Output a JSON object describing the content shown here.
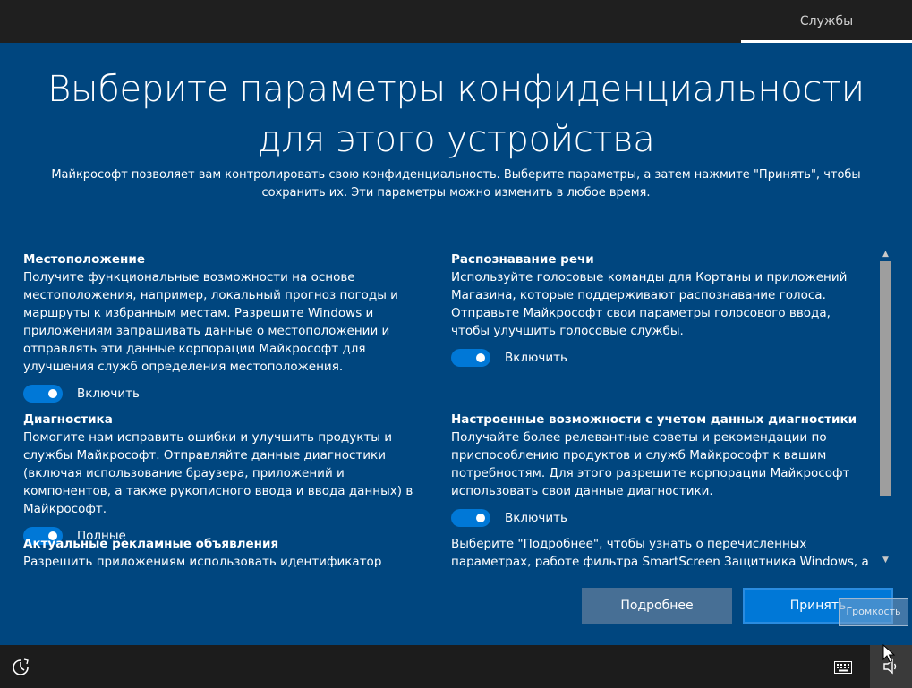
{
  "topbar": {
    "services_tab": "Службы"
  },
  "main": {
    "title": "Выберите параметры конфиденциальности для этого устройства",
    "subtitle": "Майкрософт позволяет вам контролировать свою конфиденциальность. Выберите параметры, а затем нажмите \"Принять\", чтобы сохранить их. Эти параметры можно изменить в любое время."
  },
  "sections_left": [
    {
      "title": "Местоположение",
      "text": "Получите функциональные возможности на основе местоположения, например, локальный прогноз погоды и маршруты к избранным местам. Разрешите Windows и приложениям запрашивать данные о местоположении и отправлять эти данные корпорации Майкрософт для улучшения служб определения местоположения.",
      "toggle_label": "Включить",
      "toggle_on": true
    },
    {
      "title": "Диагностика",
      "text": "Помогите нам исправить ошибки и улучшить продукты и службы Майкрософт. Отправляйте данные диагностики (включая использование браузера, приложений и компонентов, а также рукописного ввода и ввода данных) в Майкрософт.",
      "toggle_label": "Полные",
      "toggle_on": true
    },
    {
      "title": "Актуальные рекламные объявления",
      "text": "Разрешить приложениям использовать идентификатор рекламы,"
    }
  ],
  "sections_right": [
    {
      "title": "Распознавание речи",
      "text": "Используйте голосовые команды для Кортаны и приложений Магазина, которые поддерживают распознавание голоса. Отправьте Майкрософт свои параметры голосового ввода, чтобы улучшить голосовые службы.",
      "toggle_label": "Включить",
      "toggle_on": true
    },
    {
      "title": "Настроенные возможности с учетом данных диагностики",
      "text": "Получайте более релевантные советы и рекомендации по приспособлению продуктов и служб Майкрософт к вашим потребностям. Для этого разрешите корпорации Майкрософт использовать свои данные диагностики.",
      "toggle_label": "Включить",
      "toggle_on": true
    },
    {
      "text": "Выберите \"Подробнее\", чтобы узнать о перечисленных параметрах, работе фильтра SmartScreen Защитника Windows, а также передаче"
    }
  ],
  "buttons": {
    "more": "Подробнее",
    "accept": "Принять"
  },
  "tooltip": "Громкость",
  "colors": {
    "panel_bg": "#00467f",
    "accent": "#0078d7",
    "secondary_button": "#476f95"
  }
}
